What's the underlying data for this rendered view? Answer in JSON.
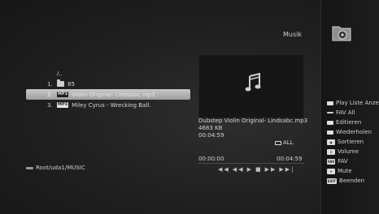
{
  "header": {
    "title": "Musik",
    "folder_icon": "music-folder-icon"
  },
  "file_list": {
    "items": [
      {
        "index": "",
        "label": "/..",
        "icon": ""
      },
      {
        "index": "1.",
        "label": "85",
        "icon": "folder-icon"
      },
      {
        "index": "2.",
        "label": "Violin Original- Lindsabc.mp3",
        "icon": "mp3-badge",
        "badge": "MP3",
        "selected": true
      },
      {
        "index": "3.",
        "label": "Miley Cyrus - Wrecking Ball.",
        "icon": "mp3-badge",
        "badge": "MP3"
      }
    ]
  },
  "path": "Root/uda1/MUSIC",
  "now_playing": {
    "art_icon": "music-note-icon",
    "filename": "Dubstep Violin Original- Lindsabc.mp3",
    "size": "4683 KB",
    "duration": "00:04:59",
    "repeat_mode": "ALL",
    "time_elapsed": "00:00:00",
    "time_total": "00:04:59",
    "controls": [
      "rewind-fast",
      "rewind",
      "play",
      "stop",
      "forward",
      "forward-fast"
    ]
  },
  "menu": {
    "items": [
      {
        "key": "red",
        "label": "Play Liste Anzeige"
      },
      {
        "key": "green",
        "label": "FAV All"
      },
      {
        "key": "yellow",
        "label": "Editieren"
      },
      {
        "key": "blue",
        "label": "Wiederholen"
      },
      {
        "key": "btn",
        "btn_text": "◉",
        "label": "Sortieren"
      },
      {
        "key": "btn",
        "btn_text": "↕",
        "label": "Volume"
      },
      {
        "key": "btn",
        "btn_text": "FAV",
        "label": "FAV"
      },
      {
        "key": "btn",
        "btn_text": "✕",
        "label": "Mute"
      },
      {
        "key": "btn",
        "btn_text": "EXIT",
        "label": "Beenden"
      }
    ]
  },
  "colors": {
    "selection": "#b8b8b8",
    "background": "#1f1f1f",
    "text": "#d8d8d8"
  }
}
